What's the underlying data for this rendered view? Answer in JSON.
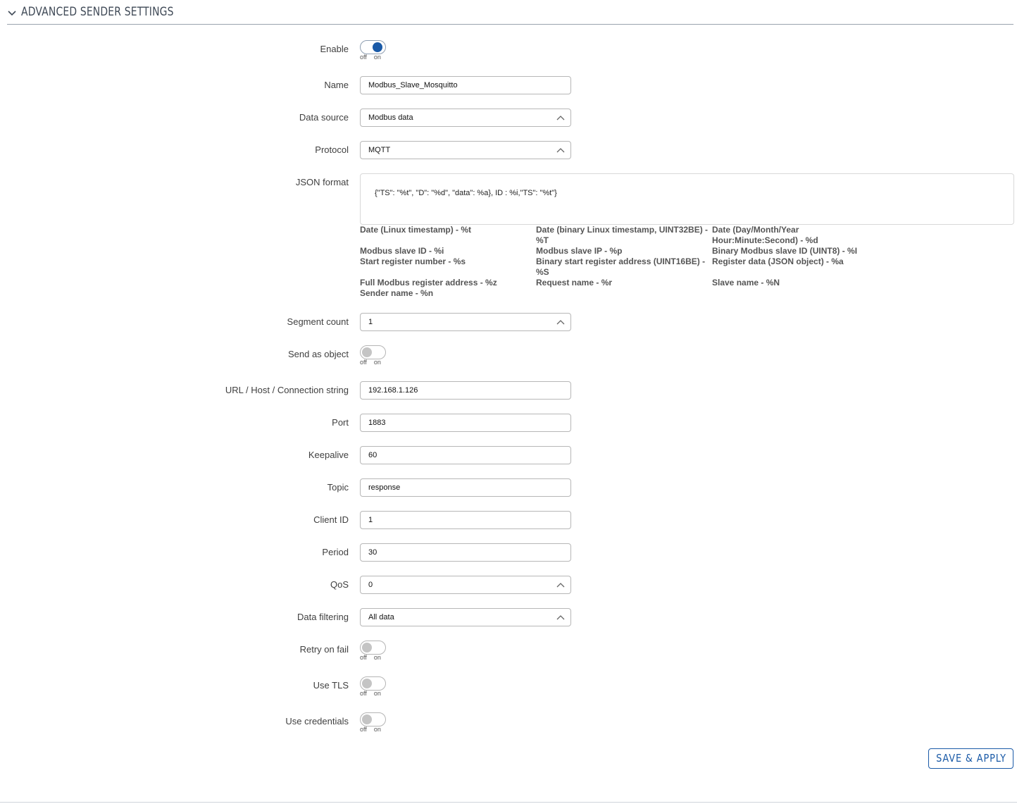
{
  "section": {
    "title": "ADVANCED SENDER SETTINGS"
  },
  "toggle_labels": {
    "off": "off",
    "on": "on"
  },
  "fields": {
    "enable": {
      "label": "Enable",
      "state": "on"
    },
    "name": {
      "label": "Name",
      "value": "Modbus_Slave_Mosquitto"
    },
    "data_source": {
      "label": "Data source",
      "value": "Modbus data"
    },
    "protocol": {
      "label": "Protocol",
      "value": "MQTT"
    },
    "json_format": {
      "label": "JSON format",
      "value": "{\"TS\": \"%t\", \"D\": \"%d\", \"data\": %a}, ID : %i,\"TS\": \"%t\"}"
    },
    "segment_count": {
      "label": "Segment count",
      "value": "1"
    },
    "send_as_object": {
      "label": "Send as object",
      "state": "off"
    },
    "url": {
      "label": "URL / Host / Connection string",
      "value": "192.168.1.126"
    },
    "port": {
      "label": "Port",
      "value": "1883"
    },
    "keepalive": {
      "label": "Keepalive",
      "value": "60"
    },
    "topic": {
      "label": "Topic",
      "value": "response"
    },
    "client_id": {
      "label": "Client ID",
      "value": "1"
    },
    "period": {
      "label": "Period",
      "value": "30"
    },
    "qos": {
      "label": "QoS",
      "value": "0"
    },
    "data_filtering": {
      "label": "Data filtering",
      "value": "All data"
    },
    "retry_on_fail": {
      "label": "Retry on fail",
      "state": "off"
    },
    "use_tls": {
      "label": "Use TLS",
      "state": "off"
    },
    "use_credentials": {
      "label": "Use credentials",
      "state": "off"
    }
  },
  "json_hints": [
    "Date (Linux timestamp) - %t",
    "Date (binary Linux timestamp, UINT32BE) - %T",
    "Date (Day/Month/Year Hour:Minute:Second) - %d",
    "Modbus slave ID - %i",
    "Modbus slave IP - %p",
    "Binary Modbus slave ID (UINT8) - %I",
    "Start register number - %s",
    "Binary start register address (UINT16BE) - %S",
    "Register data (JSON object) - %a",
    "Full Modbus register address - %z",
    "Request name - %r",
    "Slave name - %N",
    "Sender name - %n"
  ],
  "buttons": {
    "save_apply": "SAVE & APPLY"
  },
  "icons": {
    "section_toggle": "chevron-down-icon",
    "select_caret": "chevron-up-icon"
  },
  "colors": {
    "accent": "#1a5aa7",
    "toggle_off": "#c4c4c4"
  }
}
